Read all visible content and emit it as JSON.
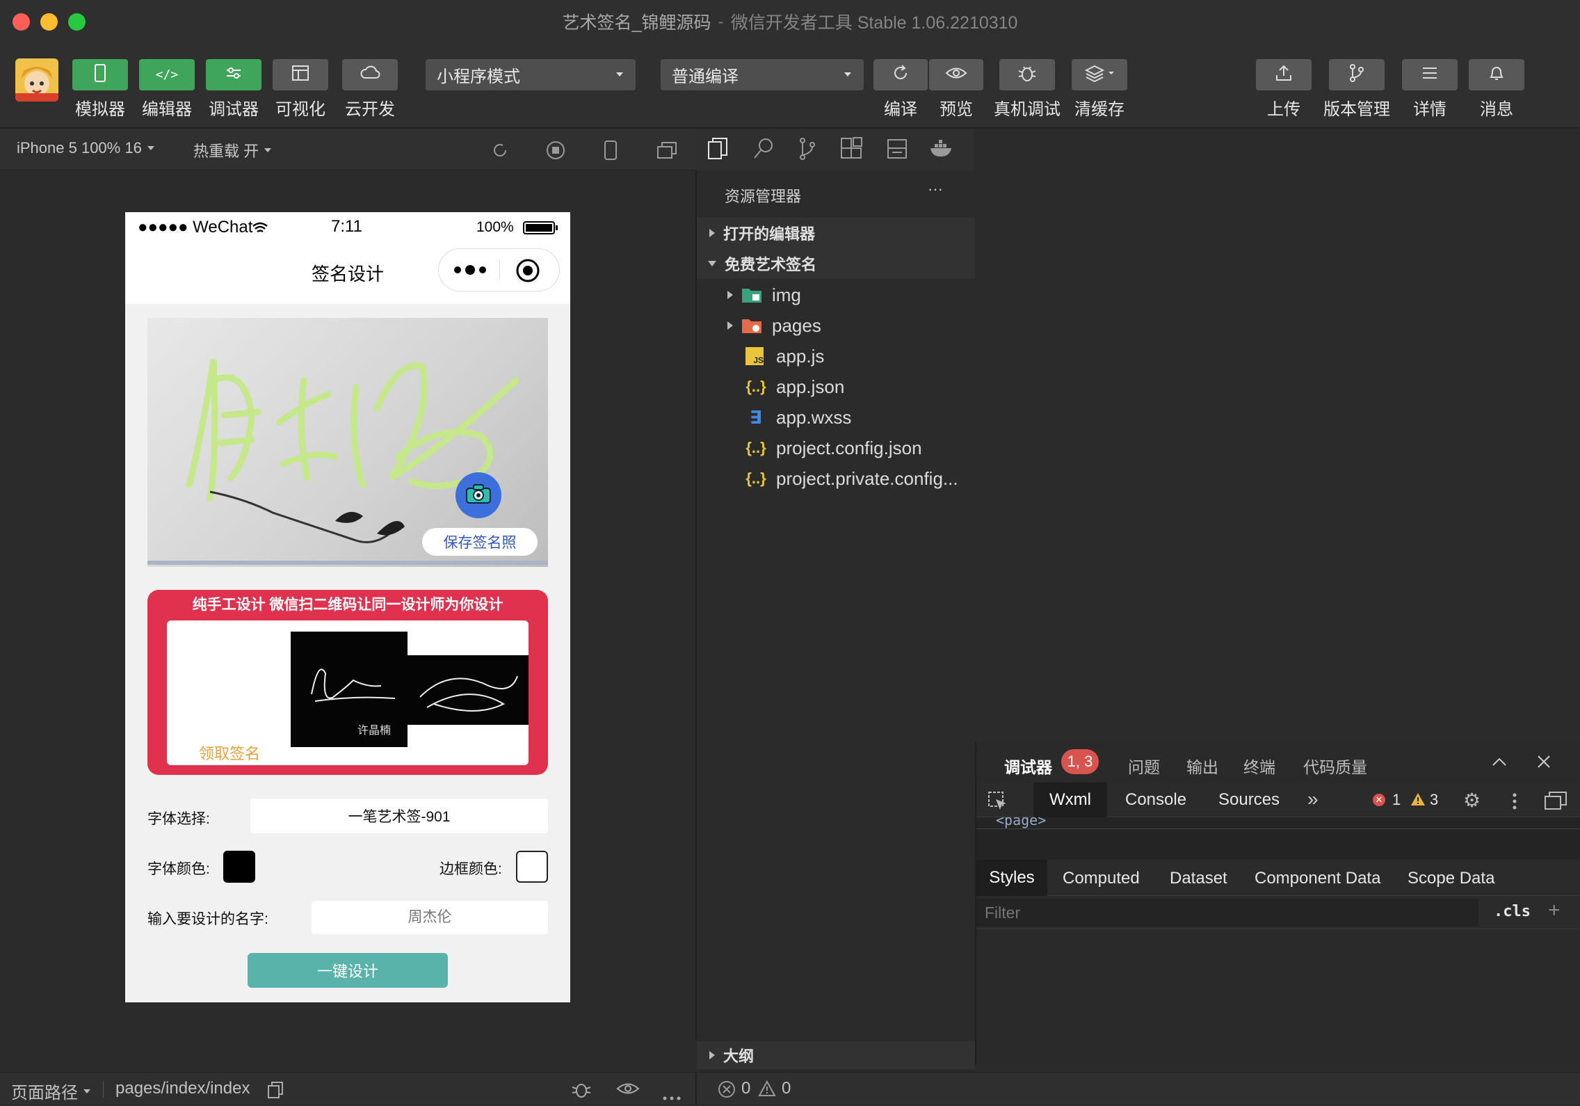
{
  "window": {
    "title": "艺术签名_锦鲤源码",
    "subtitle": "微信开发者工具 Stable 1.06.2210310"
  },
  "toolbar": {
    "left_buttons": [
      {
        "label": "模拟器",
        "icon": "phone-icon"
      },
      {
        "label": "编辑器",
        "icon": "code-icon"
      },
      {
        "label": "调试器",
        "icon": "sliders-icon"
      },
      {
        "label": "可视化",
        "icon": "layout-icon"
      },
      {
        "label": "云开发",
        "icon": "cloud-icon"
      }
    ],
    "mode_select": "小程序模式",
    "compile_select": "普通编译",
    "mid_buttons": [
      {
        "label": "编译",
        "icon": "refresh-icon"
      },
      {
        "label": "预览",
        "icon": "eye-icon"
      },
      {
        "label": "真机调试",
        "icon": "bug-icon"
      },
      {
        "label": "清缓存",
        "icon": "layers-icon"
      }
    ],
    "right_buttons": [
      {
        "label": "上传",
        "icon": "upload-icon"
      },
      {
        "label": "版本管理",
        "icon": "branch-icon"
      },
      {
        "label": "详情",
        "icon": "menu-icon"
      },
      {
        "label": "消息",
        "icon": "bell-icon"
      }
    ]
  },
  "simulator": {
    "device": "iPhone 5 100% 16",
    "hot_reload": "热重载 开"
  },
  "phone": {
    "carrier": "●●●●● WeChat",
    "time": "7:11",
    "battery": "100%",
    "nav_title": "签名设计",
    "save_photo": "保存签名照",
    "banner_title": "纯手工设计 微信扫二维码让同一设计师为你设计",
    "get_signature": "领取签名",
    "sample_name": "许晶楠",
    "font_label": "字体选择:",
    "font_value": "一笔艺术签-901",
    "font_color_label": "字体颜色:",
    "font_color": "#000000",
    "border_color_label": "边框颜色:",
    "border_color": "#ffffff",
    "name_label": "输入要设计的名字:",
    "name_placeholder": "周杰伦",
    "design_button": "一键设计"
  },
  "explorer": {
    "title": "资源管理器",
    "more": "···",
    "open_editors": "打开的编辑器",
    "project": "免费艺术签名",
    "files": [
      {
        "name": "img",
        "type": "folder-img"
      },
      {
        "name": "pages",
        "type": "folder-pages"
      },
      {
        "name": "app.js",
        "type": "js"
      },
      {
        "name": "app.json",
        "type": "json"
      },
      {
        "name": "app.wxss",
        "type": "css"
      },
      {
        "name": "project.config.json",
        "type": "json"
      },
      {
        "name": "project.private.config...",
        "type": "json"
      }
    ],
    "outline": "大纲",
    "errors": "0",
    "warnings": "0"
  },
  "debugger": {
    "tabs": [
      "调试器",
      "问题",
      "输出",
      "终端",
      "代码质量"
    ],
    "badge": "1, 3",
    "devtools_tabs": [
      "Wxml",
      "Console",
      "Sources"
    ],
    "more_tabs": "»",
    "error_count": "1",
    "warning_count": "3",
    "wxml_partial": "<page>",
    "style_tabs": [
      "Styles",
      "Computed",
      "Dataset",
      "Component Data",
      "Scope Data"
    ],
    "filter_placeholder": "Filter",
    "cls": ".cls",
    "plus": "+"
  },
  "bottom": {
    "page_path_label": "页面路径",
    "page_path": "pages/index/index"
  },
  "colors": {
    "accent_green": "#3fa55b",
    "banner_red": "#e0324f",
    "button_teal": "#5ab3ab",
    "orange_text": "#e9a23a",
    "error_red": "#d9534f"
  }
}
